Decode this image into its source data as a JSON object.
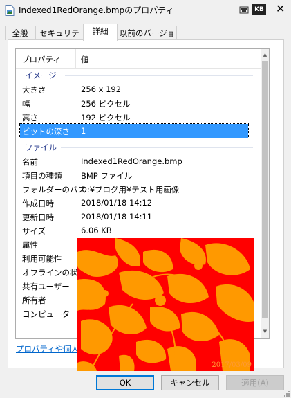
{
  "window": {
    "title": "Indexed1RedOrange.bmpのプロパティ",
    "keyboard_indicator": "KB"
  },
  "tabs": [
    {
      "label": "全般"
    },
    {
      "label": "セキュリティ"
    },
    {
      "label": "詳細",
      "active": true
    },
    {
      "label": "以前のバージョン"
    }
  ],
  "list": {
    "headers": {
      "property": "プロパティ",
      "value": "値"
    },
    "groups": {
      "image": "イメージ",
      "file": "ファイル"
    },
    "image_rows": [
      {
        "key": "大きさ",
        "value": "256 x 192"
      },
      {
        "key": "幅",
        "value": "256 ピクセル"
      },
      {
        "key": "高さ",
        "value": "192 ピクセル"
      },
      {
        "key": "ビットの深さ",
        "value": "1",
        "selected": true
      }
    ],
    "file_rows": [
      {
        "key": "名前",
        "value": "Indexed1RedOrange.bmp"
      },
      {
        "key": "項目の種類",
        "value": "BMP ファイル"
      },
      {
        "key": "フォルダーのパス",
        "value": "D:¥ブログ用¥テスト用画像"
      },
      {
        "key": "作成日時",
        "value": "2018/01/18 14:12"
      },
      {
        "key": "更新日時",
        "value": "2018/01/18 14:11"
      },
      {
        "key": "サイズ",
        "value": "6.06 KB"
      },
      {
        "key": "属性",
        "value": ""
      },
      {
        "key": "利用可能性",
        "value": ""
      },
      {
        "key": "オフラインの状態",
        "value": ""
      },
      {
        "key": "共有ユーザー",
        "value": ""
      },
      {
        "key": "所有者",
        "value": ""
      },
      {
        "key": "コンピューター",
        "value": ""
      }
    ]
  },
  "link_text": "プロパティや個人情",
  "photo": {
    "date_stamp": "2017/03/09",
    "colors": {
      "background": "#ff0000",
      "foreground": "#ff9900"
    }
  },
  "buttons": {
    "ok": "OK",
    "cancel": "キャンセル",
    "apply": "適用(A)"
  },
  "colors": {
    "selection": "#3399ff",
    "group_header": "#1e3287",
    "link": "#0066cc",
    "ok_border": "#0078d7"
  }
}
